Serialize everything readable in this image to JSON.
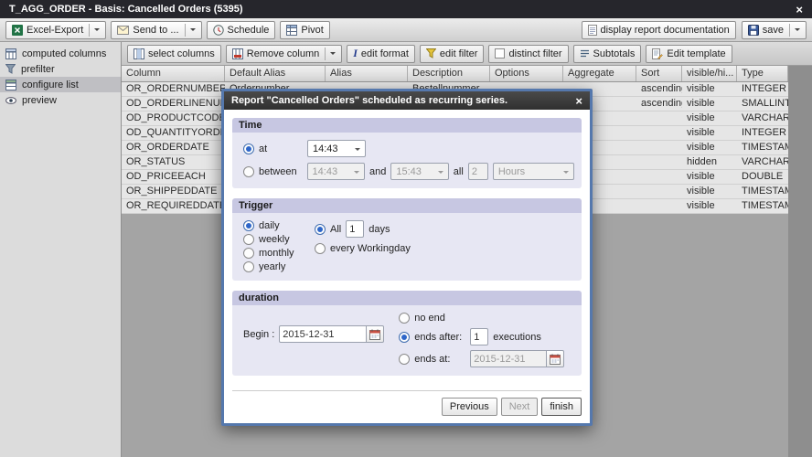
{
  "window": {
    "title": "T_AGG_ORDER - Basis: Cancelled Orders (5395)",
    "close": "×"
  },
  "icons": {
    "close_glyph": "×"
  },
  "toolbar": {
    "excel_export": "Excel-Export",
    "send_to": "Send to ...",
    "schedule": "Schedule",
    "pivot": "Pivot",
    "display_report_documentation": "display report documentation",
    "save": "save"
  },
  "sidebar": {
    "items": [
      {
        "label": "computed columns"
      },
      {
        "label": "prefilter"
      },
      {
        "label": "configure list"
      },
      {
        "label": "preview"
      }
    ]
  },
  "list_toolbar": {
    "select_columns": "select columns",
    "remove_column": "Remove column",
    "edit_format": "edit format",
    "edit_filter": "edit filter",
    "distinct_filter": "distinct filter",
    "subtotals": "Subtotals",
    "edit_template": "Edit template"
  },
  "table": {
    "columns": [
      "Column",
      "Default Alias",
      "Alias",
      "Description",
      "Options",
      "Aggregate",
      "Sort",
      "visible/hi...",
      "Type"
    ],
    "rows": [
      {
        "column": "OR_ORDERNUMBER",
        "default_alias": "Ordernumber",
        "description": "Bestellnummer",
        "sort": "ascending",
        "visible": "visible",
        "type": "INTEGER"
      },
      {
        "column": "OD_ORDERLINENUMBER",
        "sort": "ascending",
        "visible": "visible",
        "type": "SMALLINT"
      },
      {
        "column": "OD_PRODUCTCODE",
        "visible": "visible",
        "type": "VARCHAR"
      },
      {
        "column": "OD_QUANTITYORDERED",
        "visible": "visible",
        "type": "INTEGER"
      },
      {
        "column": "OR_ORDERDATE",
        "visible": "visible",
        "type": "TIMESTAMP"
      },
      {
        "column": "OR_STATUS",
        "visible": "hidden",
        "type": "VARCHAR"
      },
      {
        "column": "OD_PRICEEACH",
        "visible": "visible",
        "type": "DOUBLE"
      },
      {
        "column": "OR_SHIPPEDDATE",
        "visible": "visible",
        "type": "TIMESTAMP"
      },
      {
        "column": "OR_REQUIREDDATE",
        "visible": "visible",
        "type": "TIMESTAMP"
      }
    ]
  },
  "dialog": {
    "title": "Report \"Cancelled Orders\" scheduled as recurring series.",
    "close": "×",
    "time": {
      "heading": "Time",
      "at_label": "at",
      "at_value": "14:43",
      "between_label": "between",
      "between_from": "14:43",
      "and_label": "and",
      "between_to": "15:43",
      "all_label": "all",
      "interval_value": "2",
      "interval_unit": "Hours"
    },
    "trigger": {
      "heading": "Trigger",
      "options": [
        "daily",
        "weekly",
        "monthly",
        "yearly"
      ],
      "all_label": "All",
      "all_value": "1",
      "days_label": "days",
      "workingday_label": "every Workingday"
    },
    "duration": {
      "heading": "duration",
      "begin_label": "Begin :",
      "begin_value": "2015-12-31",
      "no_end_label": "no end",
      "ends_after_label": "ends after:",
      "ends_after_value": "1",
      "executions_label": "executions",
      "ends_at_label": "ends at:",
      "ends_at_value": "2015-12-31"
    },
    "footer": {
      "previous": "Previous",
      "next": "Next",
      "finish": "finish"
    }
  }
}
